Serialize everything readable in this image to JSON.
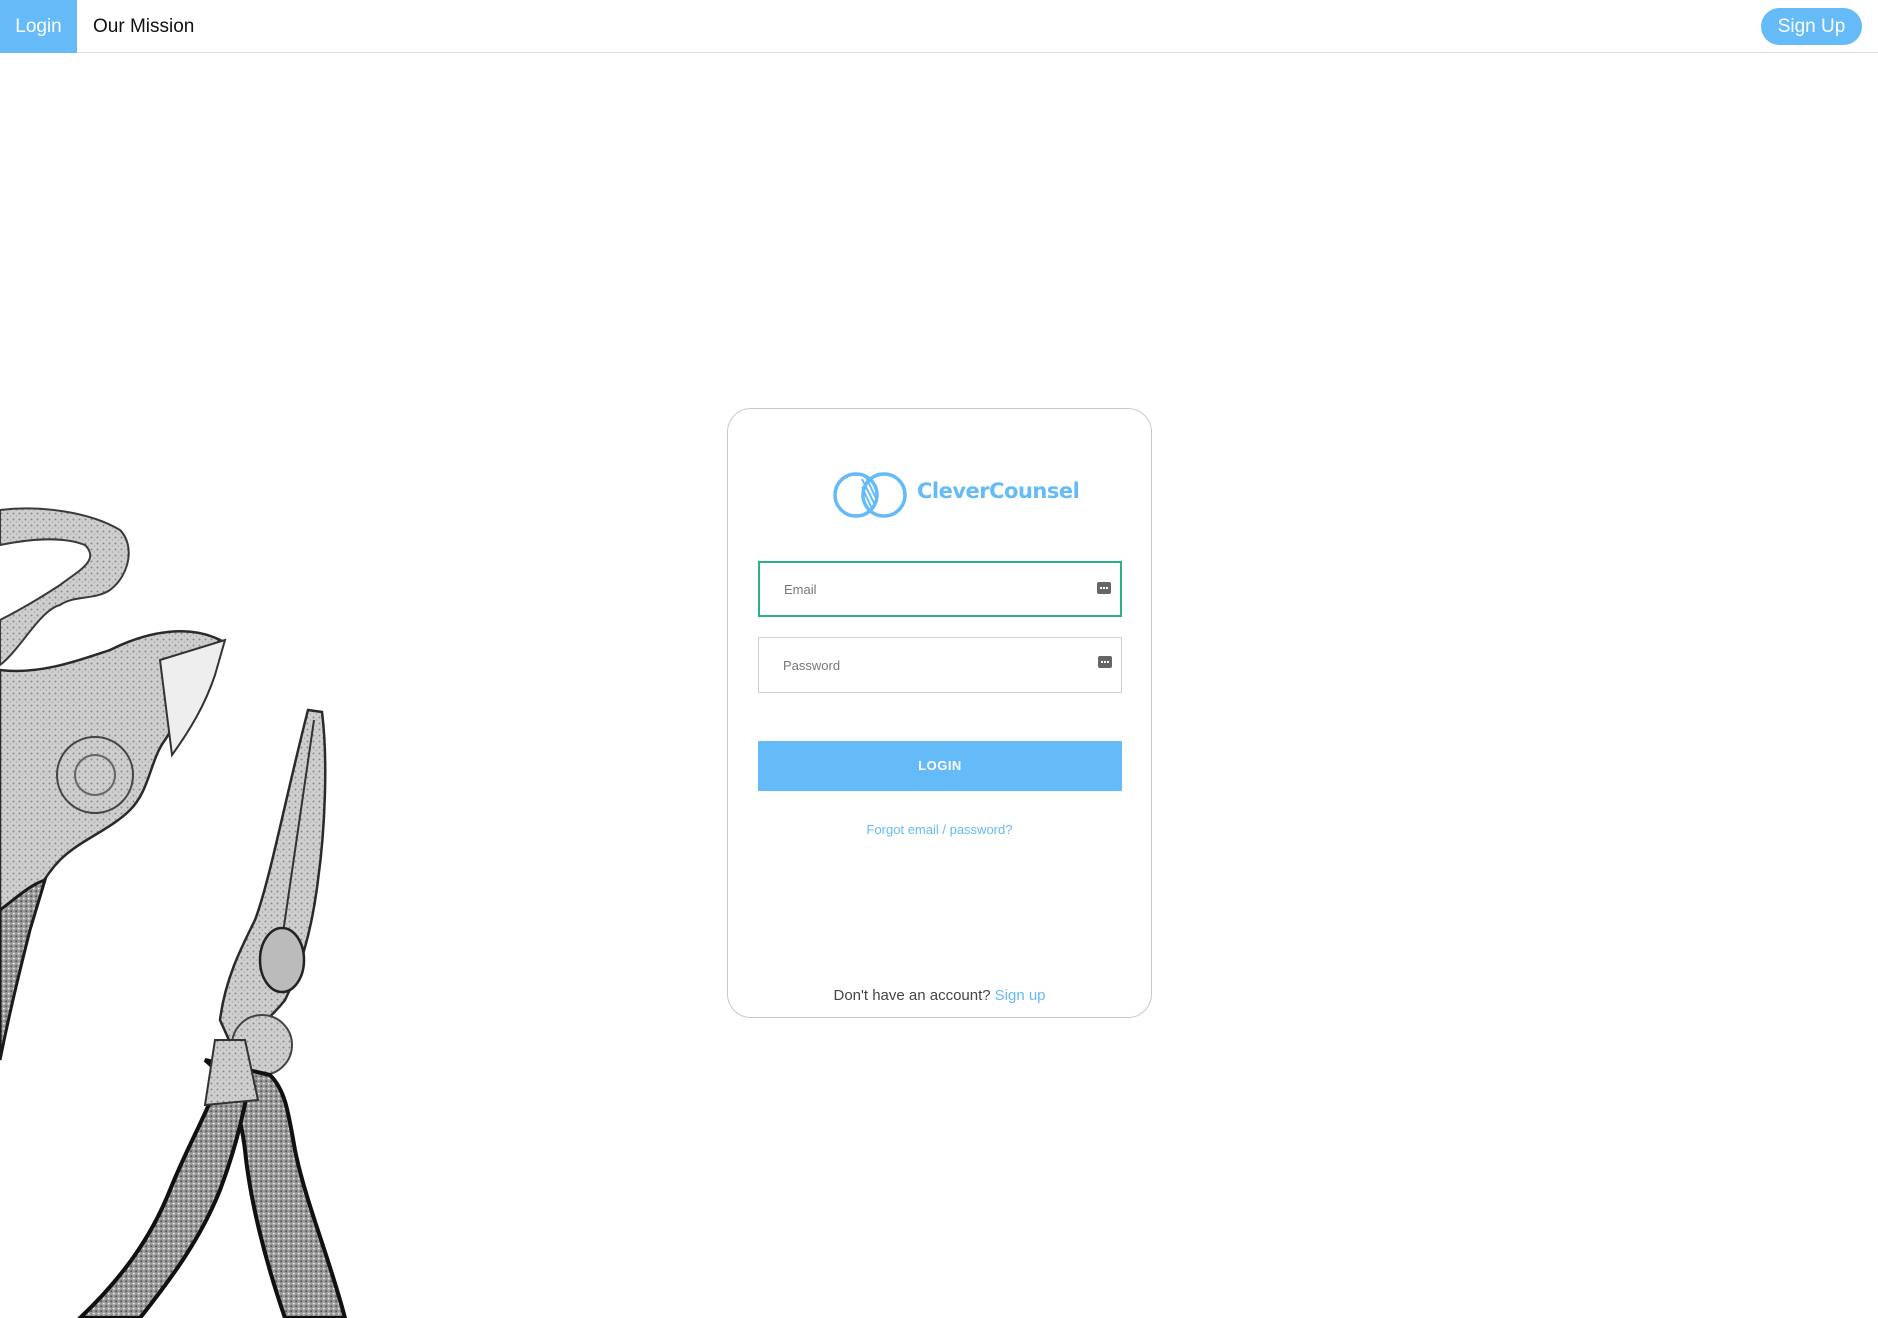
{
  "nav": {
    "login_label": "Login",
    "mission_label": "Our Mission",
    "signup_label": "Sign Up"
  },
  "brand": {
    "name": "CleverCounsel",
    "accent_color": "#64bbf8"
  },
  "form": {
    "email_placeholder": "Email",
    "password_placeholder": "Password",
    "login_button": "LOGIN",
    "forgot_link": "Forgot email / password?",
    "no_account_text": "Don't have an account?",
    "signup_link": "Sign up"
  },
  "icons": {
    "field_icon": "password-manager-icon",
    "background_art": "pliers-illustration"
  }
}
